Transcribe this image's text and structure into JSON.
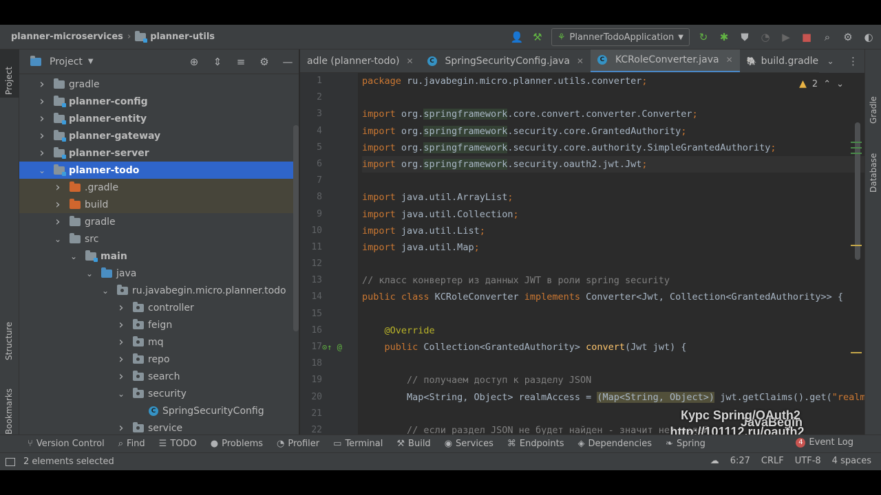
{
  "breadcrumb": {
    "root": "planner-microservices",
    "module": "planner-utils"
  },
  "run_config": {
    "label": "PlannerTodoApplication"
  },
  "left_stripe": {
    "project": "Project",
    "structure": "Structure",
    "bookmarks": "Bookmarks"
  },
  "right_stripe": {
    "gradle": "Gradle",
    "database": "Database"
  },
  "project_panel": {
    "title": "Project"
  },
  "tree": [
    {
      "label": "gradle",
      "indent": 0,
      "arrow": "right",
      "icon": "folder",
      "style": "normal"
    },
    {
      "label": "planner-config",
      "indent": 0,
      "arrow": "right",
      "icon": "module",
      "style": "bold"
    },
    {
      "label": "planner-entity",
      "indent": 0,
      "arrow": "right",
      "icon": "module",
      "style": "bold"
    },
    {
      "label": "planner-gateway",
      "indent": 0,
      "arrow": "right",
      "icon": "module",
      "style": "bold"
    },
    {
      "label": "planner-server",
      "indent": 0,
      "arrow": "right",
      "icon": "module",
      "style": "bold"
    },
    {
      "label": "planner-todo",
      "indent": 0,
      "arrow": "down",
      "icon": "module",
      "style": "selected"
    },
    {
      "label": ".gradle",
      "indent": 1,
      "arrow": "right",
      "icon": "orange",
      "style": "excluded"
    },
    {
      "label": "build",
      "indent": 1,
      "arrow": "right",
      "icon": "orange",
      "style": "excluded"
    },
    {
      "label": "gradle",
      "indent": 1,
      "arrow": "right",
      "icon": "folder",
      "style": "normal"
    },
    {
      "label": "src",
      "indent": 1,
      "arrow": "down",
      "icon": "folder",
      "style": "normal"
    },
    {
      "label": "main",
      "indent": 2,
      "arrow": "down",
      "icon": "module",
      "style": "bold"
    },
    {
      "label": "java",
      "indent": 3,
      "arrow": "down",
      "icon": "blue",
      "style": "normal"
    },
    {
      "label": "ru.javabegin.micro.planner.todo",
      "indent": 4,
      "arrow": "down",
      "icon": "package",
      "style": "normal"
    },
    {
      "label": "controller",
      "indent": 5,
      "arrow": "right",
      "icon": "package",
      "style": "normal"
    },
    {
      "label": "feign",
      "indent": 5,
      "arrow": "right",
      "icon": "package",
      "style": "normal"
    },
    {
      "label": "mq",
      "indent": 5,
      "arrow": "right",
      "icon": "package",
      "style": "normal"
    },
    {
      "label": "repo",
      "indent": 5,
      "arrow": "right",
      "icon": "package",
      "style": "normal"
    },
    {
      "label": "search",
      "indent": 5,
      "arrow": "right",
      "icon": "package",
      "style": "normal"
    },
    {
      "label": "security",
      "indent": 5,
      "arrow": "down",
      "icon": "package",
      "style": "normal"
    },
    {
      "label": "SpringSecurityConfig",
      "indent": 6,
      "arrow": "none",
      "icon": "class",
      "style": "normal"
    },
    {
      "label": "service",
      "indent": 5,
      "arrow": "right",
      "icon": "package",
      "style": "normal"
    }
  ],
  "tabs": [
    {
      "label": "adle (planner-todo)",
      "icon": "gradle",
      "active": false
    },
    {
      "label": "SpringSecurityConfig.java",
      "icon": "class",
      "active": false
    },
    {
      "label": "KCRoleConverter.java",
      "icon": "class",
      "active": true
    },
    {
      "label": "build.gradle (planner-utils)",
      "icon": "gradle",
      "active": false
    }
  ],
  "editor": {
    "warnings_count": "2",
    "lines": [
      {
        "n": "1",
        "html": "<span class='kw'>package</span> ru.javabegin.micro.planner.utils.converter<span class='kw'>;</span>"
      },
      {
        "n": "2",
        "html": ""
      },
      {
        "n": "3",
        "html": "<span class='kw'>import</span> org.<span class='hl'>springframework</span>.core.convert.converter.Converter<span class='kw'>;</span>"
      },
      {
        "n": "4",
        "html": "<span class='kw'>import</span> org.<span class='hl'>springframework</span>.security.core.GrantedAuthority<span class='kw'>;</span>"
      },
      {
        "n": "5",
        "html": "<span class='kw'>import</span> org.<span class='hl'>springframework</span>.security.core.authority.SimpleGrantedAuthority<span class='kw'>;</span>"
      },
      {
        "n": "6",
        "html": "<span class='kw'>import</span> org.<span class='hl'>springframework</span>.security.oauth2.jwt.Jwt<span class='kw'>;</span>",
        "cur": true
      },
      {
        "n": "7",
        "html": ""
      },
      {
        "n": "8",
        "html": "<span class='kw'>import</span> java.util.ArrayList<span class='kw'>;</span>"
      },
      {
        "n": "9",
        "html": "<span class='kw'>import</span> java.util.Collection<span class='kw'>;</span>"
      },
      {
        "n": "10",
        "html": "<span class='kw'>import</span> java.util.List<span class='kw'>;</span>"
      },
      {
        "n": "11",
        "html": "<span class='kw'>import</span> java.util.Map<span class='kw'>;</span>"
      },
      {
        "n": "12",
        "html": ""
      },
      {
        "n": "13",
        "html": "<span class='cm'>// класс конвертер из данных JWT в роли spring security</span>"
      },
      {
        "n": "14",
        "html": "<span class='kw'>public class</span> KCRoleConverter <span class='kw'>implements</span> Converter&lt;Jwt, Collection&lt;GrantedAuthority&gt;&gt; {"
      },
      {
        "n": "15",
        "html": ""
      },
      {
        "n": "16",
        "html": "    <span class='an'>@Override</span>"
      },
      {
        "n": "17",
        "html": "    <span class='kw'>public</span> Collection&lt;GrantedAuthority&gt; <span class='fn'>convert</span>(Jwt jwt) {"
      },
      {
        "n": "18",
        "html": ""
      },
      {
        "n": "19",
        "html": "        <span class='cm'>// получаем доступ к разделу JSON</span>"
      },
      {
        "n": "20",
        "html": "        Map&lt;String, Object&gt; realmAccess = <span class='cast'>(Map&lt;String, Object&gt;)</span> jwt.getClaims().get(<span class='kw'>\"realm_access\"</span>)<span class='kw'>;</span>"
      },
      {
        "n": "21",
        "html": ""
      },
      {
        "n": "22",
        "html": "        <span class='cm'>// если раздел JSON не будет найден - значит нет ролей</span>"
      }
    ]
  },
  "watermark": {
    "line1": "JavaBegin",
    "line2": "Курс Spring/OAuth2",
    "line3": "http://101112.ru/oauth2"
  },
  "tool_windows": [
    {
      "label": "Version Control",
      "glyph": "⑂"
    },
    {
      "label": "Find",
      "glyph": "⌕"
    },
    {
      "label": "TODO",
      "glyph": "☰"
    },
    {
      "label": "Problems",
      "glyph": "●"
    },
    {
      "label": "Profiler",
      "glyph": "◔"
    },
    {
      "label": "Terminal",
      "glyph": "▭"
    },
    {
      "label": "Build",
      "glyph": "⚒"
    },
    {
      "label": "Services",
      "glyph": "◉"
    },
    {
      "label": "Endpoints",
      "glyph": "⌘"
    },
    {
      "label": "Dependencies",
      "glyph": "◈"
    },
    {
      "label": "Spring",
      "glyph": "❧"
    }
  ],
  "event_log": {
    "label": "Event Log",
    "count": "4"
  },
  "status": {
    "message": "2 elements selected",
    "position": "6:27",
    "line_sep": "CRLF",
    "encoding": "UTF-8",
    "indent": "4 spaces"
  }
}
